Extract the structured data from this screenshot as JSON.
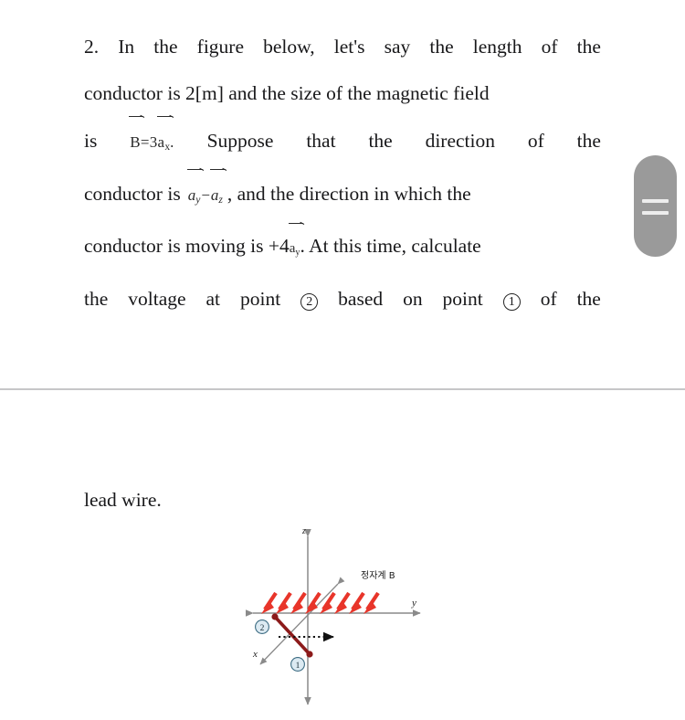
{
  "document": {
    "question_number": "2.",
    "paragraph_lines": [
      {
        "id": "line1",
        "words": [
          "2.",
          "In",
          "the",
          "figure",
          "below,",
          "let's",
          "say",
          "the",
          "length",
          "of",
          "the"
        ]
      },
      {
        "id": "line2",
        "words": [
          "conductor",
          "is",
          "2[m]",
          "and",
          "the",
          "size",
          "of",
          "the",
          "magnetic",
          "field"
        ]
      },
      {
        "id": "line3",
        "prefix": "is",
        "formula": "B=3a_x",
        "formula_parts": {
          "lhs": "B",
          "equals": "=",
          "coefficient": "3",
          "unit_vector": "a",
          "subscript": "x"
        },
        "suffix_words": [
          "Suppose",
          "that",
          "the",
          "direction",
          "of",
          "the"
        ]
      },
      {
        "id": "line4",
        "prefix": "conductor is",
        "formula": "a_y - a_z",
        "formula_parts": {
          "first_vector": "a",
          "first_subscript": "y",
          "operator": "−",
          "second_vector": "a",
          "second_subscript": "z"
        },
        "suffix": ", and the direction in which the"
      },
      {
        "id": "line5",
        "prefix": "conductor is moving is +4",
        "formula_parts": {
          "unit_vector": "a",
          "subscript": "y"
        },
        "suffix": ". At this time, calculate"
      },
      {
        "id": "line6",
        "segments": [
          {
            "type": "text",
            "value": "the"
          },
          {
            "type": "text",
            "value": "voltage"
          },
          {
            "type": "text",
            "value": "at"
          },
          {
            "type": "text",
            "value": "point"
          },
          {
            "type": "circle",
            "value": "2"
          },
          {
            "type": "text",
            "value": "based"
          },
          {
            "type": "text",
            "value": "on"
          },
          {
            "type": "text",
            "value": "point"
          },
          {
            "type": "circle",
            "value": "1"
          },
          {
            "type": "text",
            "value": "of"
          },
          {
            "type": "text",
            "value": "the"
          }
        ]
      }
    ],
    "continuation_text": "lead wire."
  },
  "line1_text": "2. In the figure below, let's say the length of the",
  "line2_text": "conductor is 2[m] and the size of the magnetic field",
  "line3": {
    "prefix": "is",
    "B": "B",
    "eq": "=3",
    "a": "a",
    "sub": "x",
    "w1": "Suppose",
    "w2": "that",
    "w3": "the",
    "w4": "direction",
    "w5": "of",
    "w6": "the",
    "period": "."
  },
  "line4": {
    "prefix": "conductor is",
    "a1": "a",
    "sub1": "y",
    "op": "−",
    "a2": "a",
    "sub2": "z",
    "suffix": ", and the direction in which the"
  },
  "line5": {
    "prefix": "conductor is moving is +4",
    "a": "a",
    "sub": "y",
    "suffix": ". At this time, calculate"
  },
  "line6": {
    "w1": "the",
    "w2": "voltage",
    "w3": "at",
    "w4": "point",
    "c1": "2",
    "w5": "based",
    "w6": "on",
    "w7": "point",
    "c2": "1",
    "w8": "of",
    "w9": "the"
  },
  "leadwire_text": "lead wire.",
  "handle": {
    "name": "drag-handle",
    "color": "#9a9a9a",
    "bar_color": "#ededed"
  },
  "figure": {
    "caption": "정자계 B",
    "axis_labels": {
      "x": "x",
      "y": "y",
      "z": "z"
    },
    "point_labels": {
      "p1": "1",
      "p2": "2"
    },
    "colors": {
      "field_arrow": "#e8352a",
      "conductor": "#8c1a1a",
      "axis": "#8a8a8a",
      "point_circle_fill": "#dceaf2",
      "point_circle_stroke": "#3b6b82"
    },
    "field_arrow_count": 8,
    "field_direction": "down-left",
    "motion_arrow": "dotted-right"
  }
}
